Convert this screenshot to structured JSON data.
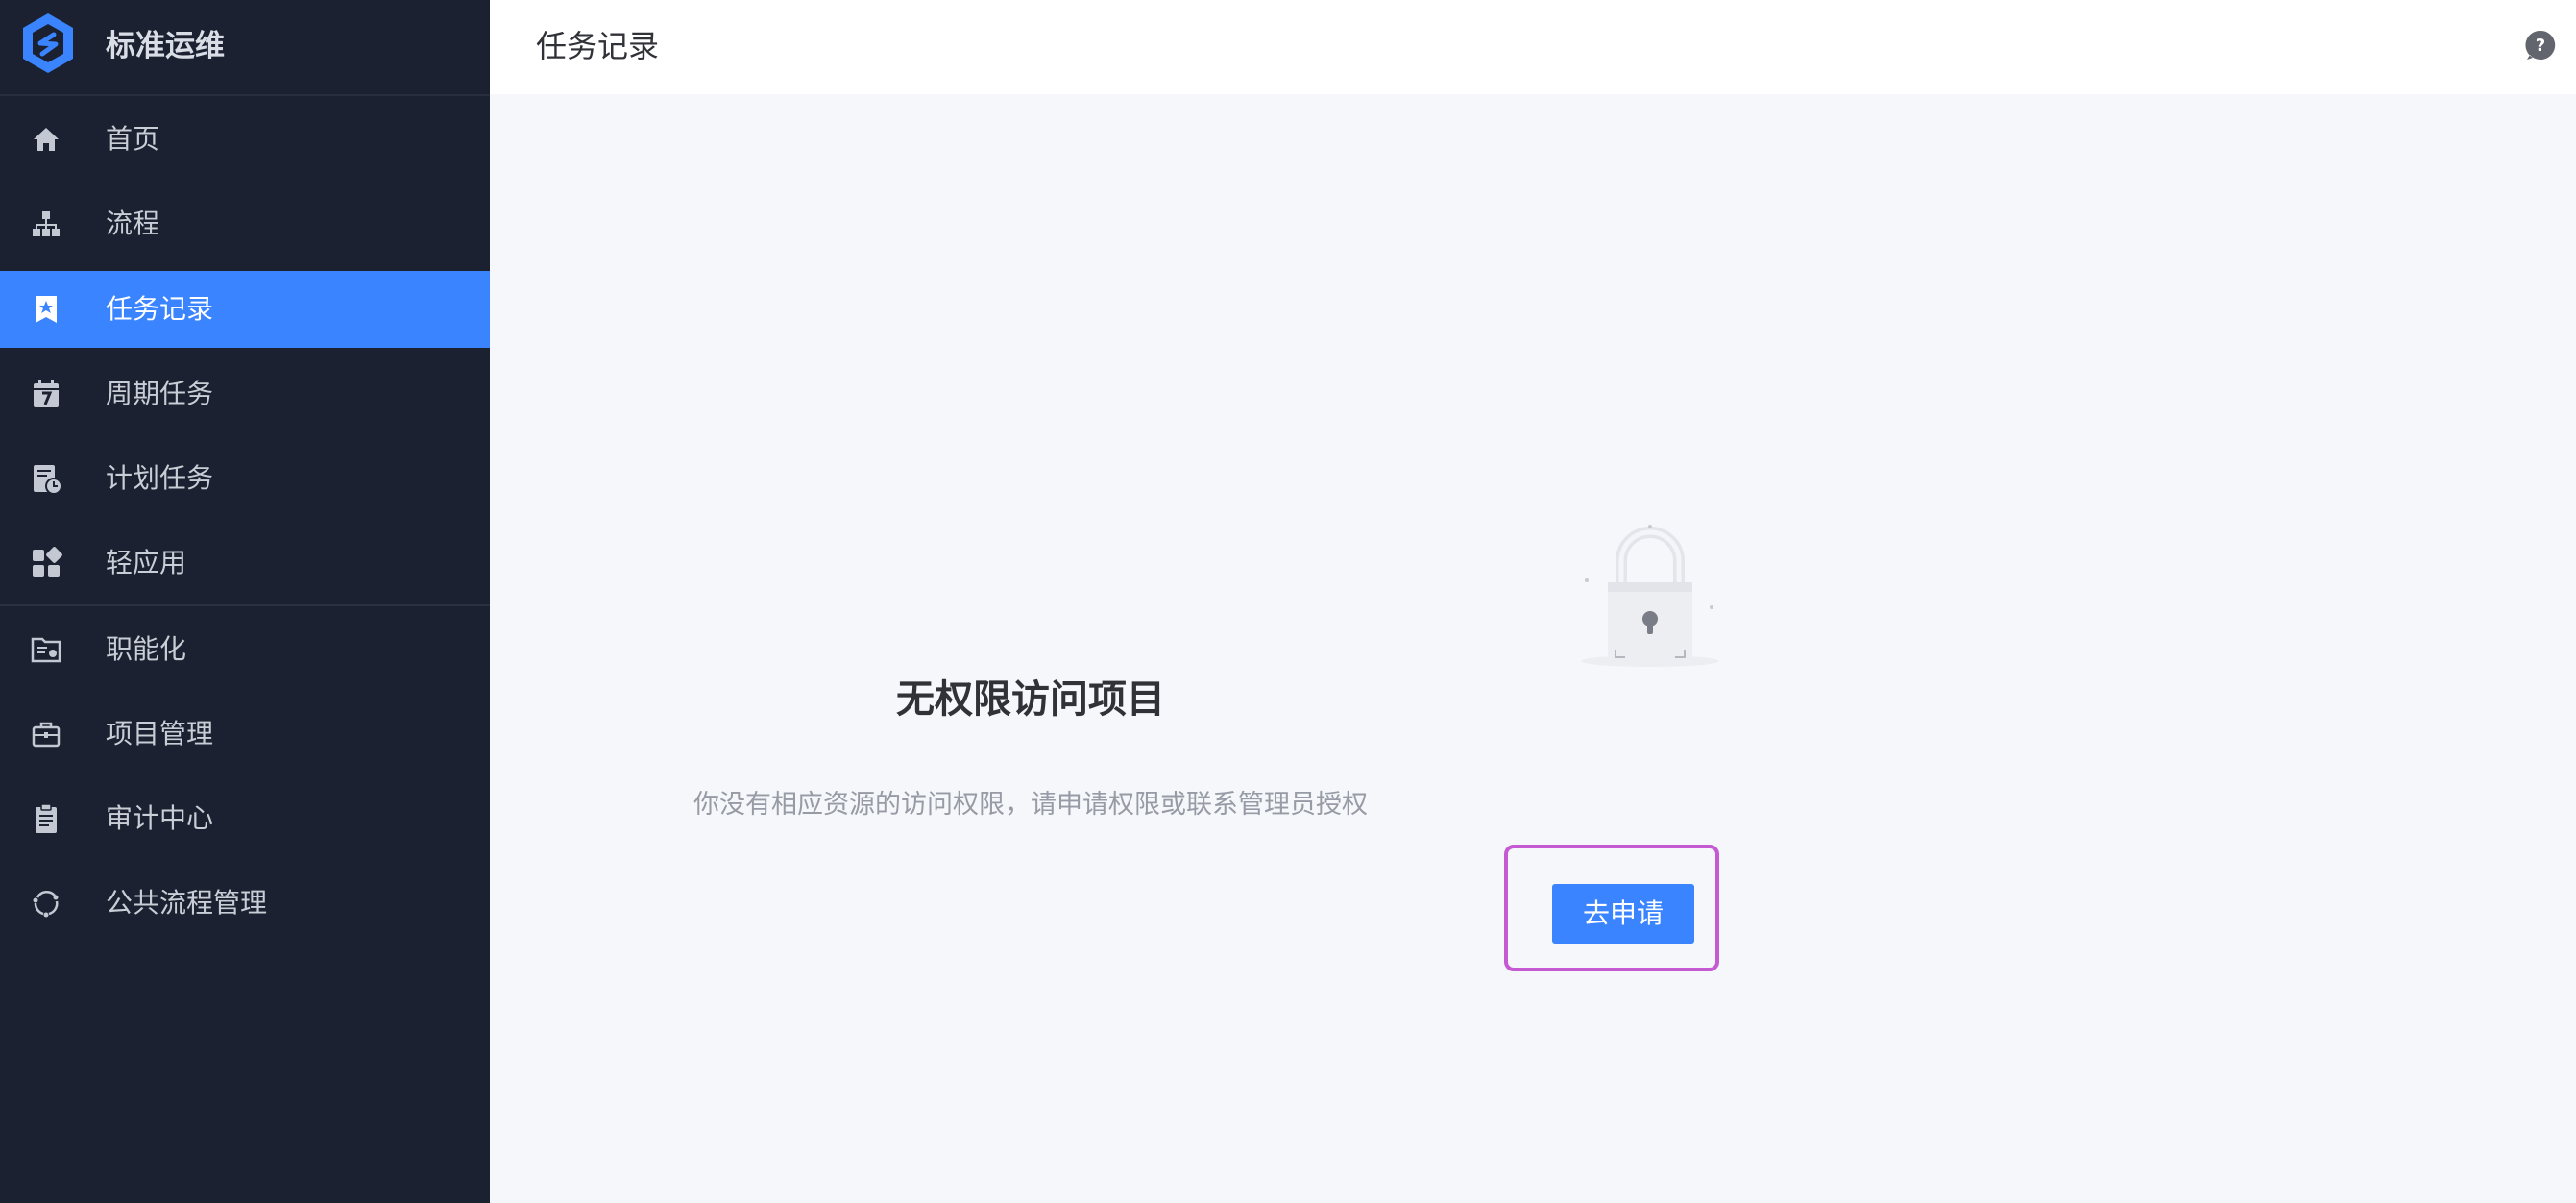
{
  "brand": {
    "title": "标准运维",
    "logo_icon": "standard-ops-logo-icon",
    "accent": "#3a84ff"
  },
  "sidebar": {
    "items": [
      {
        "label": "首页",
        "icon": "home-icon",
        "active": false
      },
      {
        "label": "流程",
        "icon": "flow-tree-icon",
        "active": false
      },
      {
        "label": "任务记录",
        "icon": "bookmark-star-icon",
        "active": true
      },
      {
        "label": "周期任务",
        "icon": "calendar-icon",
        "active": false
      },
      {
        "label": "计划任务",
        "icon": "schedule-clock-icon",
        "active": false
      },
      {
        "label": "轻应用",
        "icon": "apps-grid-icon",
        "active": false
      },
      {
        "label": "职能化",
        "icon": "functional-folder-icon",
        "active": false
      },
      {
        "label": "项目管理",
        "icon": "briefcase-icon",
        "active": false
      },
      {
        "label": "审计中心",
        "icon": "clipboard-icon",
        "active": false
      },
      {
        "label": "公共流程管理",
        "icon": "cycle-icon",
        "active": false
      }
    ]
  },
  "header": {
    "title": "任务记录",
    "help_icon": "help-icon"
  },
  "main": {
    "illustration": "lock-icon",
    "title": "无权限访问项目",
    "description": "你没有相应资源的访问权限，请申请权限或联系管理员授权",
    "apply_button": "去申请"
  },
  "colors": {
    "sidebar_bg": "#1b2130",
    "active_bg": "#3a84ff",
    "highlight": "#c45bd2"
  }
}
